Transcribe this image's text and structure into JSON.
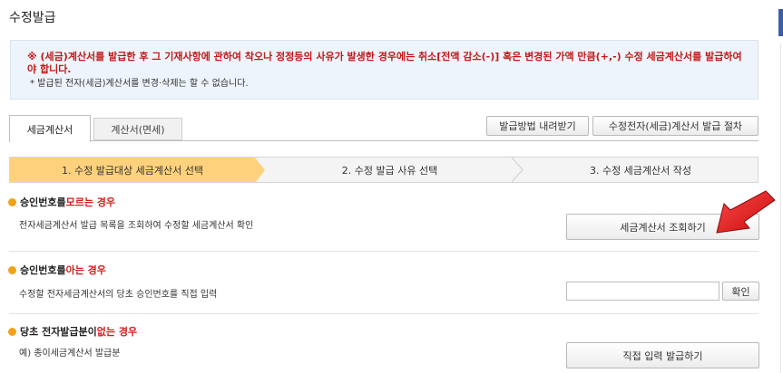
{
  "page": {
    "title": "수정발급"
  },
  "notice": {
    "main": "※ (세금)계산서를 발급한 후 그 기재사항에 관하여 착오나 정정등의 사유가 발생한 경우에는 취소[전액 감소(-)] 혹은 변경된 가액 만큼(+,-) 수정 세금계산서를 발급하여야 합니다.",
    "sub": "* 발급된 전자(세금)계산서를 변경·삭제는 할 수 없습니다."
  },
  "tabs": [
    {
      "label": "세금계산서"
    },
    {
      "label": "계산서(면세)"
    }
  ],
  "toolbar": {
    "download_label": "발급방법 내려받기",
    "procedure_label": "수정전자(세금)계산서 발급 절차"
  },
  "steps": [
    {
      "label": "1. 수정 발급대상 세금계산서 선택"
    },
    {
      "label": "2. 수정 발급 사유 선택"
    },
    {
      "label": "3. 수정 세금계산서 작성"
    }
  ],
  "sections": {
    "unknown": {
      "title_prefix": "승인번호를 ",
      "title_emph": "모르는 경우",
      "desc": "전자세금계산서 발급 목록을 조회하여 수정할 세금계산서 확인",
      "button": "세금계산서 조회하기"
    },
    "known": {
      "title_prefix": "승인번호를 ",
      "title_emph": "아는 경우",
      "desc": "수정할 전자세금계산서의 당초 승인번호를 직접 입력",
      "input_value": "",
      "button": "확인"
    },
    "none": {
      "title_prefix": "당초 전자발급분이 ",
      "title_emph": "없는 경우",
      "desc": "예) 종이세금계산서 발급분",
      "button": "직접 입력 발급하기"
    }
  },
  "colors": {
    "accent_step": "#fed27c",
    "notice_red": "#c21818",
    "emphasis_red": "#d41c1c",
    "bullet_orange": "#f0a21c",
    "arrow_red": "#e01414"
  }
}
